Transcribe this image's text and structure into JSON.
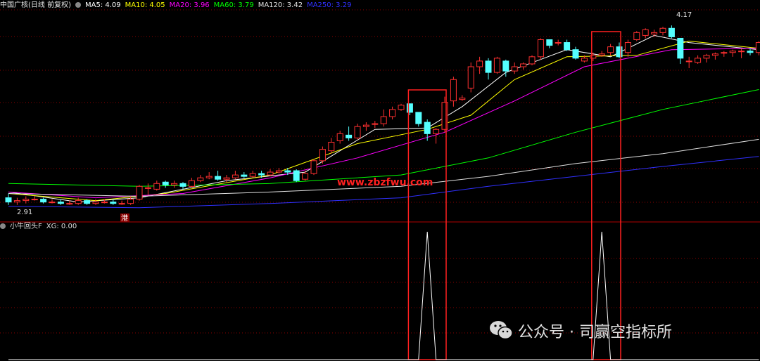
{
  "header": {
    "security": "中国广核(日线 前复权)",
    "ma": [
      {
        "label": "MA5: 4.09",
        "color": "#ffffff"
      },
      {
        "label": "MA10: 4.05",
        "color": "#ffff00"
      },
      {
        "label": "MA20: 3.96",
        "color": "#ff00ff"
      },
      {
        "label": "MA60: 3.79",
        "color": "#00ff00"
      },
      {
        "label": "MA120: 3.42",
        "color": "#e0e0e0"
      },
      {
        "label": "MA250: 3.29",
        "color": "#3030ff"
      }
    ]
  },
  "indicator_header": {
    "name": "小牛回头F",
    "value": "XG: 0.00"
  },
  "annotations": {
    "low_label": "2.91",
    "high_label": "4.17",
    "hk_tag": "港",
    "watermark_url": "www.zbzfwu.com"
  },
  "watermark": {
    "text": "公众号 · 司赢空指标所",
    "icon": "wechat-icon"
  },
  "colors": {
    "up": "#ff3030",
    "down": "#54ffff",
    "box": "#ff2020",
    "grid": "#8b0000"
  },
  "chart_data": [
    {
      "type": "candlestick",
      "title": "中国广核(日线 前复权)",
      "price_range": [
        2.8,
        4.25
      ],
      "grid": true,
      "candles": [
        [
          2.96,
          2.93,
          2.99,
          2.91
        ],
        [
          2.93,
          2.94,
          2.96,
          2.91
        ],
        [
          2.94,
          2.95,
          2.97,
          2.92
        ],
        [
          2.95,
          2.95,
          2.97,
          2.94
        ],
        [
          2.95,
          2.93,
          2.96,
          2.92
        ],
        [
          2.93,
          2.93,
          2.95,
          2.92
        ],
        [
          2.93,
          2.92,
          2.95,
          2.91
        ],
        [
          2.92,
          2.92,
          2.94,
          2.91
        ],
        [
          2.92,
          2.94,
          2.96,
          2.91
        ],
        [
          2.94,
          2.92,
          2.95,
          2.91
        ],
        [
          2.92,
          2.93,
          2.95,
          2.91
        ],
        [
          2.93,
          2.93,
          2.95,
          2.92
        ],
        [
          2.93,
          2.92,
          2.95,
          2.91
        ],
        [
          2.92,
          2.92,
          2.94,
          2.91
        ],
        [
          2.92,
          2.95,
          2.97,
          2.91
        ],
        [
          2.95,
          3.04,
          3.05,
          2.94
        ],
        [
          3.03,
          3.03,
          3.06,
          2.98
        ],
        [
          3.02,
          3.06,
          3.08,
          3.01
        ],
        [
          3.07,
          3.05,
          3.08,
          3.03
        ],
        [
          3.05,
          3.06,
          3.08,
          3.03
        ],
        [
          3.06,
          3.04,
          3.07,
          3.02
        ],
        [
          3.04,
          3.08,
          3.1,
          3.03
        ],
        [
          3.08,
          3.1,
          3.12,
          3.07
        ],
        [
          3.1,
          3.11,
          3.14,
          3.09
        ],
        [
          3.11,
          3.09,
          3.15,
          3.08
        ],
        [
          3.09,
          3.1,
          3.12,
          3.07
        ],
        [
          3.1,
          3.12,
          3.15,
          3.09
        ],
        [
          3.12,
          3.11,
          3.14,
          3.1
        ],
        [
          3.11,
          3.13,
          3.15,
          3.1
        ],
        [
          3.13,
          3.12,
          3.15,
          3.1
        ],
        [
          3.12,
          3.14,
          3.16,
          3.11
        ],
        [
          3.14,
          3.15,
          3.17,
          3.13
        ],
        [
          3.15,
          3.14,
          3.17,
          3.12
        ],
        [
          3.15,
          3.08,
          3.16,
          3.07
        ],
        [
          3.09,
          3.13,
          3.15,
          3.08
        ],
        [
          3.13,
          3.22,
          3.23,
          3.12
        ],
        [
          3.22,
          3.3,
          3.32,
          3.2
        ],
        [
          3.29,
          3.35,
          3.38,
          3.27
        ],
        [
          3.36,
          3.41,
          3.43,
          3.34
        ],
        [
          3.4,
          3.38,
          3.46,
          3.36
        ],
        [
          3.38,
          3.46,
          3.48,
          3.37
        ],
        [
          3.46,
          3.47,
          3.49,
          3.43
        ],
        [
          3.48,
          3.48,
          3.5,
          3.45
        ],
        [
          3.48,
          3.53,
          3.58,
          3.46
        ],
        [
          3.53,
          3.58,
          3.6,
          3.51
        ],
        [
          3.58,
          3.61,
          3.62,
          3.57
        ],
        [
          3.62,
          3.56,
          3.62,
          3.54
        ],
        [
          3.56,
          3.48,
          3.55,
          3.46
        ],
        [
          3.49,
          3.41,
          3.51,
          3.36
        ],
        [
          3.41,
          3.44,
          3.45,
          3.34
        ],
        [
          3.44,
          3.63,
          3.67,
          3.42
        ],
        [
          3.64,
          3.79,
          3.81,
          3.6
        ],
        [
          3.65,
          3.66,
          3.68,
          3.64
        ],
        [
          3.73,
          3.88,
          3.91,
          3.7
        ],
        [
          3.88,
          3.92,
          3.95,
          3.83
        ],
        [
          3.92,
          3.84,
          3.94,
          3.79
        ],
        [
          3.84,
          3.94,
          3.95,
          3.83
        ],
        [
          3.92,
          3.85,
          3.93,
          3.81
        ],
        [
          3.85,
          3.88,
          3.91,
          3.83
        ],
        [
          3.88,
          3.9,
          3.91,
          3.86
        ],
        [
          3.9,
          3.95,
          3.96,
          3.89
        ],
        [
          3.95,
          4.07,
          4.08,
          3.93
        ],
        [
          4.07,
          4.03,
          4.06,
          4.01
        ],
        [
          4.05,
          4.05,
          4.07,
          4.03
        ],
        [
          4.05,
          4.0,
          4.07,
          3.99
        ],
        [
          4.0,
          3.94,
          4.02,
          3.93
        ],
        [
          3.92,
          3.94,
          3.96,
          3.91
        ],
        [
          3.94,
          3.96,
          3.98,
          3.92
        ],
        [
          3.96,
          3.97,
          3.99,
          3.95
        ],
        [
          3.98,
          4.02,
          4.04,
          3.96
        ],
        [
          4.02,
          3.95,
          4.05,
          3.94
        ],
        [
          3.98,
          4.05,
          4.07,
          3.95
        ],
        [
          4.07,
          4.12,
          4.13,
          4.06
        ],
        [
          4.1,
          4.14,
          4.15,
          4.08
        ],
        [
          4.11,
          4.12,
          4.14,
          4.09
        ],
        [
          4.12,
          4.15,
          4.16,
          4.1
        ],
        [
          4.15,
          4.09,
          4.17,
          4.08
        ],
        [
          4.08,
          3.94,
          4.07,
          3.9
        ],
        [
          3.92,
          3.92,
          3.95,
          3.87
        ],
        [
          3.91,
          3.94,
          3.96,
          3.9
        ],
        [
          3.94,
          3.96,
          3.97,
          3.91
        ],
        [
          3.96,
          3.97,
          3.98,
          3.93
        ],
        [
          3.98,
          3.98,
          3.99,
          3.95
        ],
        [
          3.98,
          3.99,
          4.0,
          3.95
        ],
        [
          3.99,
          3.99,
          4.01,
          3.94
        ],
        [
          3.99,
          3.98,
          4.01,
          3.96
        ],
        [
          3.98,
          4.05,
          4.06,
          3.96
        ]
      ],
      "ma": [
        {
          "name": "MA5",
          "color": "#ffffff",
          "points": [
            [
              0,
              3.0
            ],
            [
              8,
              2.93
            ],
            [
              15,
              2.96
            ],
            [
              25,
              3.08
            ],
            [
              34,
              3.14
            ],
            [
              42,
              3.44
            ],
            [
              48,
              3.45
            ],
            [
              52,
              3.6
            ],
            [
              57,
              3.84
            ],
            [
              64,
              4.0
            ],
            [
              69,
              3.95
            ],
            [
              74,
              4.1
            ],
            [
              78,
              4.05
            ],
            [
              86,
              4.0
            ]
          ]
        },
        {
          "name": "MA10",
          "color": "#ffff00",
          "points": [
            [
              0,
              2.99
            ],
            [
              10,
              2.94
            ],
            [
              18,
              2.99
            ],
            [
              30,
              3.12
            ],
            [
              40,
              3.34
            ],
            [
              48,
              3.44
            ],
            [
              53,
              3.54
            ],
            [
              58,
              3.79
            ],
            [
              64,
              3.95
            ],
            [
              72,
              3.96
            ],
            [
              78,
              4.06
            ],
            [
              86,
              4.01
            ]
          ]
        },
        {
          "name": "MA20",
          "color": "#ff00ff",
          "points": [
            [
              0,
              3.0
            ],
            [
              10,
              2.96
            ],
            [
              20,
              2.99
            ],
            [
              30,
              3.1
            ],
            [
              40,
              3.24
            ],
            [
              50,
              3.42
            ],
            [
              58,
              3.64
            ],
            [
              66,
              3.88
            ],
            [
              76,
              4.0
            ],
            [
              86,
              4.01
            ]
          ]
        },
        {
          "name": "MA60",
          "color": "#00ff00",
          "points": [
            [
              0,
              3.06
            ],
            [
              15,
              3.04
            ],
            [
              30,
              3.06
            ],
            [
              45,
              3.12
            ],
            [
              55,
              3.24
            ],
            [
              65,
              3.42
            ],
            [
              75,
              3.58
            ],
            [
              86,
              3.72
            ]
          ]
        },
        {
          "name": "MA120",
          "color": "#e0e0e0",
          "points": [
            [
              0,
              2.99
            ],
            [
              15,
              2.97
            ],
            [
              30,
              3.0
            ],
            [
              45,
              3.04
            ],
            [
              55,
              3.11
            ],
            [
              65,
              3.2
            ],
            [
              75,
              3.27
            ],
            [
              86,
              3.37
            ]
          ]
        },
        {
          "name": "MA250",
          "color": "#3030ff",
          "points": [
            [
              0,
              2.9
            ],
            [
              15,
              2.89
            ],
            [
              30,
              2.92
            ],
            [
              45,
              2.96
            ],
            [
              55,
              3.04
            ],
            [
              65,
              3.11
            ],
            [
              75,
              3.18
            ],
            [
              86,
              3.25
            ]
          ]
        }
      ],
      "signal_boxes": [
        [
          46,
          50
        ],
        [
          67,
          70
        ]
      ],
      "watermark": "www.zbzfwu.com"
    },
    {
      "type": "line",
      "name": "小牛回头F",
      "series": [
        {
          "name": "XG",
          "values": [
            [
              0,
              0
            ],
            [
              47,
              0
            ],
            [
              48,
              1
            ],
            [
              49,
              0
            ],
            [
              67,
              0
            ],
            [
              68,
              1
            ],
            [
              69,
              0
            ],
            [
              86,
              0
            ]
          ]
        }
      ],
      "ylim": [
        0,
        1
      ]
    }
  ]
}
